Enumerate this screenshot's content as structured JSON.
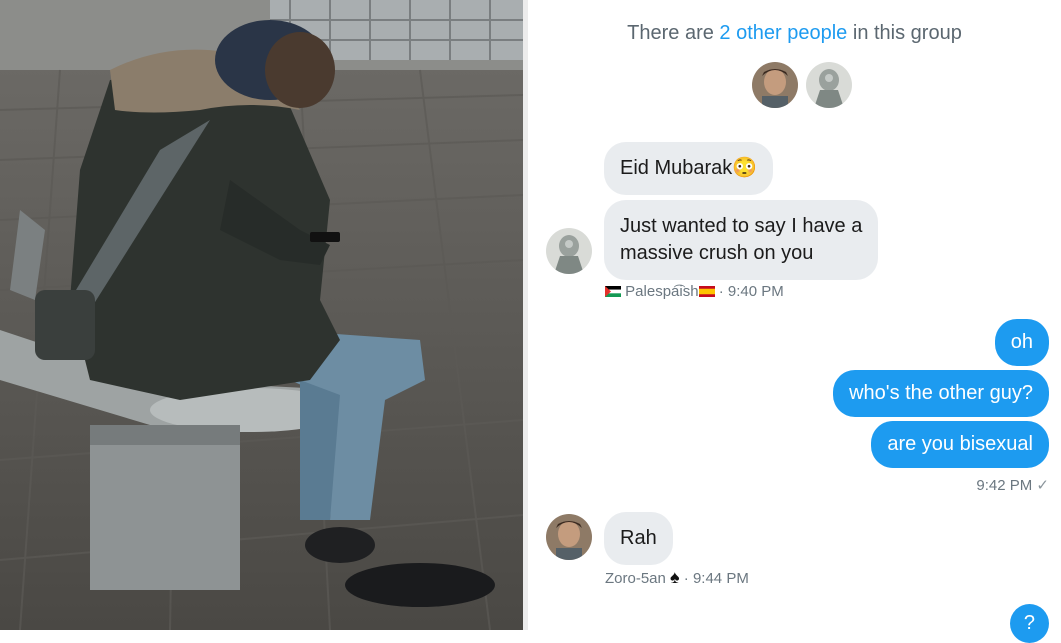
{
  "group": {
    "prefix": "There are ",
    "link": "2 other people",
    "suffix": " in this group"
  },
  "messages_in_1": {
    "m1": "Eid Mubarak😳",
    "m2_line1": "Just wanted to say I have a",
    "m2_line2": "massive crush on you",
    "sender": "Palespa͡ish",
    "time": "9:40 PM"
  },
  "messages_out": {
    "m1": "oh",
    "m2": "who's the other guy?",
    "m3": "are you bisexual",
    "time": "9:42 PM",
    "status": "✓"
  },
  "messages_in_2": {
    "m1": "Rah",
    "sender": "Zoro-5an",
    "time": "9:44 PM"
  },
  "messages_out_2": {
    "m1": "?"
  },
  "colors": {
    "accent": "#1d9bf0",
    "incoming_bubble": "#e9ecef",
    "meta_text": "#6b7780"
  }
}
